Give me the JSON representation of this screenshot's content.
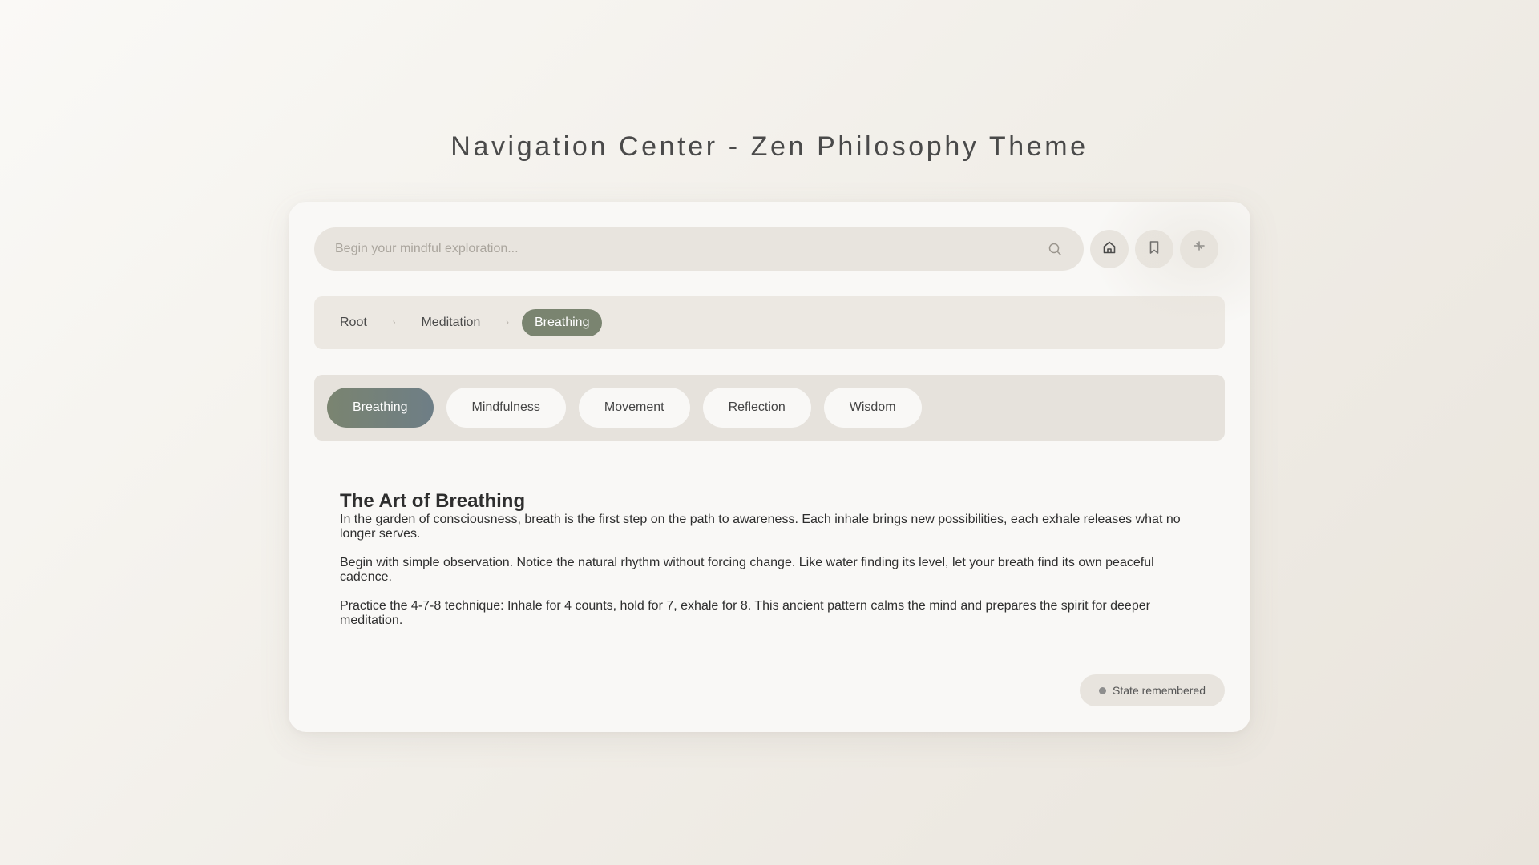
{
  "page": {
    "title": "Navigation Center - Zen Philosophy Theme"
  },
  "search": {
    "placeholder": "Begin your mindful exploration...",
    "value": "",
    "icon": "search-icon"
  },
  "toolbar": {
    "buttons": [
      {
        "icon": "home-icon"
      },
      {
        "icon": "bookmark-icon"
      },
      {
        "icon": "sparkle-icon"
      }
    ]
  },
  "breadcrumb": {
    "items": [
      {
        "label": "Root",
        "active": false
      },
      {
        "label": "Meditation",
        "active": false
      },
      {
        "label": "Breathing",
        "active": true
      }
    ],
    "separator": "›"
  },
  "tabs": {
    "items": [
      {
        "label": "Breathing",
        "active": true
      },
      {
        "label": "Mindfulness",
        "active": false
      },
      {
        "label": "Movement",
        "active": false
      },
      {
        "label": "Reflection",
        "active": false
      },
      {
        "label": "Wisdom",
        "active": false
      }
    ]
  },
  "content": {
    "heading": "The Art of Breathing",
    "paragraphs": [
      "In the garden of consciousness, breath is the first step on the path to awareness. Each inhale brings new possibilities, each exhale releases what no longer serves.",
      "Begin with simple observation. Notice the natural rhythm without forcing change. Like water finding its level, let your breath find its own peaceful cadence.",
      "Practice the 4-7-8 technique: Inhale for 4 counts, hold for 7, exhale for 8. This ancient pattern calms the mind and prepares the spirit for deeper meditation."
    ]
  },
  "status": {
    "label": "State remembered"
  },
  "colors": {
    "accent": "#7a8470",
    "accent_gradient_end": "#6e7e86",
    "surface": "#e8e4de",
    "card": "#f9f8f6"
  }
}
